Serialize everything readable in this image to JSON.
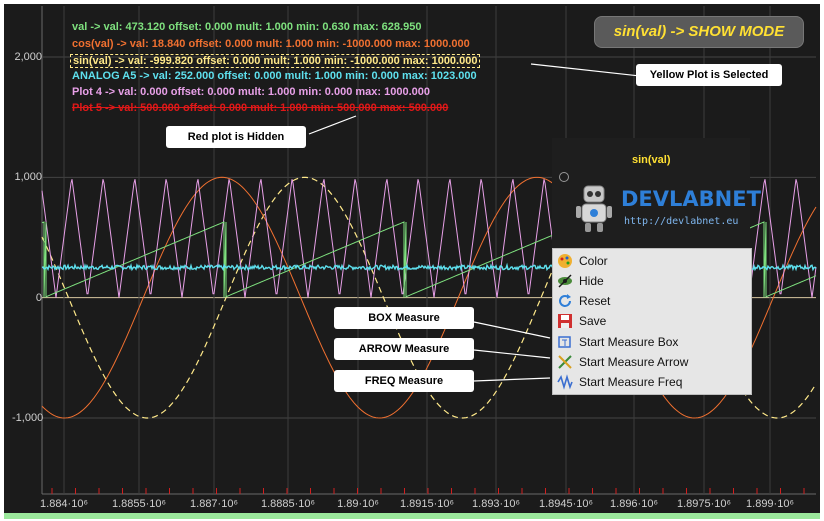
{
  "y_axis": {
    "ticks": [
      "2,000",
      "1,000",
      "0",
      "-1,000"
    ]
  },
  "x_axis": {
    "ticks": [
      "1.884·10⁶",
      "1.8855·10⁶",
      "1.887·10⁶",
      "1.8885·10⁶",
      "1.89·10⁶",
      "1.8915·10⁶",
      "1.893·10⁶",
      "1.8945·10⁶",
      "1.896·10⁶",
      "1.8975·10⁶",
      "1.899·10⁶"
    ]
  },
  "legend": [
    {
      "text": "val ->  val: 473.120 offset: 0.000 mult: 1.000 min: 0.630 max: 628.950",
      "color": "#7ee07e",
      "state": "visible"
    },
    {
      "text": "cos(val) ->  val: 18.840 offset: 0.000 mult: 1.000 min: -1000.000 max: 1000.000",
      "color": "#f07030",
      "state": "visible"
    },
    {
      "text": "sin(val) ->  val: -999.820 offset: 0.000 mult: 1.000 min: -1000.000 max: 1000.000",
      "color": "#ffe98a",
      "state": "selected"
    },
    {
      "text": "ANALOG A5 ->  val: 252.000 offset: 0.000 mult: 1.000 min: 0.000 max: 1023.000",
      "color": "#5ee0ee",
      "state": "visible"
    },
    {
      "text": "Plot 4 ->  val: 0.000 offset: 0.000 mult: 1.000 min: 0.000 max: 1000.000",
      "color": "#e8a0e8",
      "state": "visible"
    },
    {
      "text": "Plot 5 ->  val: 500.000 offset: 0.000 mult: 1.000 min: 500.000 max: 500.000",
      "color": "#e01818",
      "state": "hidden"
    }
  ],
  "mode_badge": "sin(val) -> SHOW MODE",
  "callouts": {
    "selected": "Yellow Plot is Selected",
    "hidden": "Red plot is Hidden",
    "box": "BOX Measure",
    "arrow": "ARROW Measure",
    "freq": "FREQ Measure"
  },
  "context_panel": {
    "title": "sin(val)",
    "logo_text": "DEVLABNET",
    "logo_url": "http://devlabnet.eu"
  },
  "context_menu": [
    {
      "label": "Color",
      "icon": "palette-icon"
    },
    {
      "label": "Hide",
      "icon": "hide-eye-icon"
    },
    {
      "label": "Reset",
      "icon": "refresh-icon"
    },
    {
      "label": "Save",
      "icon": "floppy-icon"
    },
    {
      "label": "Start Measure Box",
      "icon": "measure-box-icon"
    },
    {
      "label": "Start Measure Arrow",
      "icon": "measure-arrow-icon"
    },
    {
      "label": "Start Measure Freq",
      "icon": "measure-freq-icon"
    }
  ],
  "chart_data": {
    "type": "line",
    "ylim": [
      -1000,
      2000
    ],
    "series": [
      {
        "name": "val",
        "color": "#7ee07e",
        "shape": "sawtooth",
        "min": 0.63,
        "max": 628.95
      },
      {
        "name": "cos(val)",
        "color": "#f07030",
        "shape": "cosine",
        "min": -1000,
        "max": 1000
      },
      {
        "name": "sin(val)",
        "color": "#ffe98a",
        "shape": "sine",
        "min": -1000,
        "max": 1000,
        "style": "dashed"
      },
      {
        "name": "ANALOG A5",
        "color": "#5ee0ee",
        "shape": "noise",
        "min": 0,
        "max": 1023
      },
      {
        "name": "Plot 4",
        "color": "#e8a0e8",
        "shape": "triangle",
        "min": 0,
        "max": 1000
      },
      {
        "name": "Plot 5",
        "color": "#e01818",
        "shape": "constant",
        "min": 500,
        "max": 500,
        "hidden": true
      }
    ]
  }
}
